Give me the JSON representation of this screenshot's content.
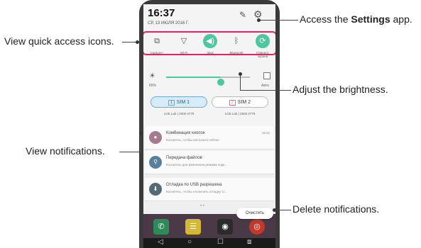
{
  "callouts": {
    "settings_prefix": "Access the ",
    "settings_bold": "Settings",
    "settings_suffix": " app.",
    "quick_access": "View quick access icons.",
    "brightness": "Adjust the brightness.",
    "notifications": "View notifications.",
    "delete": "Delete notifications."
  },
  "status": {
    "time": "16:37",
    "date": "СР, 13 ИЮЛЯ 2016 Г."
  },
  "header_icons": [
    "pencil-icon",
    "gear-icon"
  ],
  "quick_tiles": [
    {
      "label": "Capture+",
      "icon": "capture-icon",
      "active": false
    },
    {
      "label": "Wi-Fi",
      "icon": "wifi-icon",
      "active": false
    },
    {
      "label": "Звук",
      "icon": "sound-icon",
      "active": true
    },
    {
      "label": "Bluetooth",
      "icon": "bluetooth-icon",
      "active": false
    },
    {
      "label": "Поворот экрана",
      "icon": "rotate-icon",
      "active": true
    }
  ],
  "brightness": {
    "percent_label": "65%",
    "level": 0.65,
    "auto_label": "Авто"
  },
  "sims": [
    {
      "label": "SIM 1",
      "badge": "1",
      "operator": "LGE Lab | 2500 0775"
    },
    {
      "label": "SIM 2",
      "badge": "2",
      "operator": "LGE Lab | 2500 0779"
    }
  ],
  "notifications": [
    {
      "title": "Комбинация кнопок",
      "text": "Коснитесь, чтобы настроить сейчас",
      "time": "16:22",
      "icon_color": "#a77a8f"
    },
    {
      "title": "Передача файлов",
      "text": "Коснитесь для изменения режима подк...",
      "time": "",
      "icon_color": "#5a7f9c"
    },
    {
      "title": "Отладка по USB разрешена",
      "text": "Коснитесь, чтобы отключить отладку U...",
      "time": "",
      "icon_color": "#556a78"
    }
  ],
  "clear_label": "Очистить",
  "colors": {
    "accent": "#4dc7a0",
    "highlight_border": "#e91e63",
    "sim_active": "#d6ecf8"
  }
}
